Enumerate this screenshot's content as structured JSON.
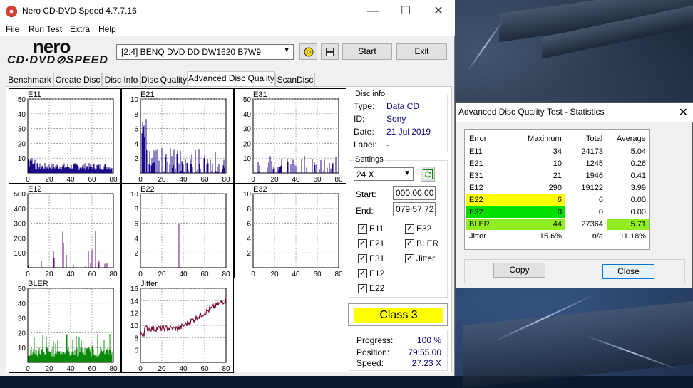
{
  "window": {
    "title": "Nero CD-DVD Speed 4.7.7.16",
    "minimize": "—",
    "maximize": "☐",
    "close": "✕"
  },
  "menu": [
    "File",
    "Run Test",
    "Extra",
    "Help"
  ],
  "logo": {
    "line1": "nero",
    "line2": "CD·DVD⊘SPEED"
  },
  "toolbar": {
    "drive": "[2:4]   BENQ DVD DD DW1620 B7W9",
    "start": "Start",
    "exit": "Exit"
  },
  "tabs": [
    "Benchmark",
    "Create Disc",
    "Disc Info",
    "Disc Quality",
    "Advanced Disc Quality",
    "ScanDisc"
  ],
  "graphs": [
    {
      "name": "E11",
      "yticks": [
        "50",
        "40",
        "30",
        "20",
        "10"
      ],
      "xticks": [
        "0",
        "20",
        "40",
        "60",
        "80"
      ]
    },
    {
      "name": "E21",
      "yticks": [
        "10",
        "8",
        "6",
        "4",
        "2"
      ],
      "xticks": [
        "0",
        "20",
        "40",
        "60",
        "80"
      ]
    },
    {
      "name": "E31",
      "yticks": [
        "50",
        "40",
        "30",
        "20",
        "10"
      ],
      "xticks": [
        "0",
        "20",
        "40",
        "60",
        "80"
      ]
    },
    {
      "name": "E12",
      "yticks": [
        "500",
        "400",
        "300",
        "200",
        "100"
      ],
      "xticks": [
        "0",
        "20",
        "40",
        "60",
        "80"
      ]
    },
    {
      "name": "E22",
      "yticks": [
        "10",
        "8",
        "6",
        "4",
        "2"
      ],
      "xticks": [
        "0",
        "20",
        "40",
        "60",
        "80"
      ]
    },
    {
      "name": "E32",
      "yticks": [
        "10",
        "8",
        "6",
        "4",
        "2"
      ],
      "xticks": [
        "0",
        "20",
        "40",
        "60",
        "80"
      ]
    },
    {
      "name": "BLER",
      "yticks": [
        "50",
        "40",
        "30",
        "20",
        "10"
      ],
      "xticks": [
        "0",
        "20",
        "40",
        "60",
        "80"
      ]
    },
    {
      "name": "Jitter",
      "yticks": [
        "16",
        "14",
        "12",
        "10",
        "8",
        "6"
      ],
      "xticks": [
        "0",
        "20",
        "40",
        "60",
        "80"
      ]
    }
  ],
  "disc_info": {
    "title": "Disc info",
    "type_label": "Type:",
    "type": "Data CD",
    "id_label": "ID:",
    "id": "Sony",
    "date_label": "Date:",
    "date": "21 Jul 2019",
    "label_label": "Label:",
    "label": "-"
  },
  "settings": {
    "title": "Settings",
    "speed": "24 X",
    "start_label": "Start:",
    "start": "000:00.00",
    "end_label": "End:",
    "end": "079:57.72",
    "checks": [
      {
        "label": "E11",
        "checked": "✓"
      },
      {
        "label": "E32",
        "checked": "✓"
      },
      {
        "label": "E21",
        "checked": "✓"
      },
      {
        "label": "BLER",
        "checked": "✓"
      },
      {
        "label": "E31",
        "checked": "✓"
      },
      {
        "label": "Jitter",
        "checked": "✓"
      },
      {
        "label": "E12",
        "checked": "✓"
      },
      {
        "label": "E22",
        "checked": "✓"
      }
    ]
  },
  "class_result": "Class 3",
  "progress": {
    "progress_label": "Progress:",
    "progress": "100 %",
    "position_label": "Position:",
    "position": "79:55.00",
    "speed_label": "Speed:",
    "speed": "27.23 X"
  },
  "stats": {
    "title": "Advanced Disc Quality Test - Statistics",
    "close": "✕",
    "headers": [
      "Error",
      "Maximum",
      "Total",
      "Average"
    ],
    "rows": [
      {
        "error": "E11",
        "maximum": "34",
        "total": "24173",
        "average": "5.04"
      },
      {
        "error": "E21",
        "maximum": "10",
        "total": "1245",
        "average": "0.26"
      },
      {
        "error": "E31",
        "maximum": "21",
        "total": "1946",
        "average": "0.41"
      },
      {
        "error": "E12",
        "maximum": "290",
        "total": "19122",
        "average": "3.99"
      },
      {
        "error": "E22",
        "maximum": "6",
        "total": "6",
        "average": "0.00"
      },
      {
        "error": "E32",
        "maximum": "0",
        "total": "0",
        "average": "0.00"
      },
      {
        "error": "BLER",
        "maximum": "44",
        "total": "27364",
        "average": "5.71"
      },
      {
        "error": "Jitter",
        "maximum": "15.6%",
        "total": "n/a",
        "average": "11.18%"
      }
    ],
    "copy": "Copy",
    "close_button": "Close"
  },
  "colors": {
    "e_series": "#1a0a8a",
    "e2_series": "#6a0a7a",
    "bler": "#0a8a0a",
    "jitter": "#7a0a2a",
    "class_bg": "#ffff00",
    "row_yellow": "#ffff00",
    "row_green": "#00e000",
    "row_lime": "#90ee20"
  }
}
